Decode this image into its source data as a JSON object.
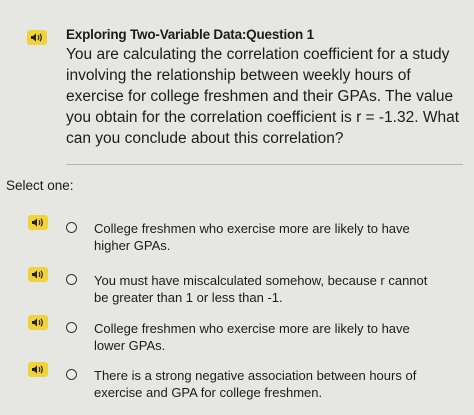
{
  "question": {
    "title": "Exploring Two-Variable Data:Question 1",
    "text": "You are calculating the correlation coefficient for a study involving the relationship between weekly hours of exercise for college freshmen and their GPAs.  The value you obtain for the correlation coefficient is r = -1.32.  What can you conclude about this correlation?"
  },
  "prompt_label": "Select one:",
  "options": [
    {
      "text": "College freshmen who exercise more are likely to have higher GPAs."
    },
    {
      "text": "You must have miscalculated somehow, because r cannot be greater than 1 or less than -1."
    },
    {
      "text": "College freshmen who exercise more are likely to have lower GPAs."
    },
    {
      "text": "There is a strong negative association between hours of exercise and GPA for college freshmen."
    }
  ],
  "icons": {
    "audio": "speaker-audio-icon"
  },
  "colors": {
    "audio_badge": "#f0d23a",
    "background": "#e6e7e3"
  }
}
